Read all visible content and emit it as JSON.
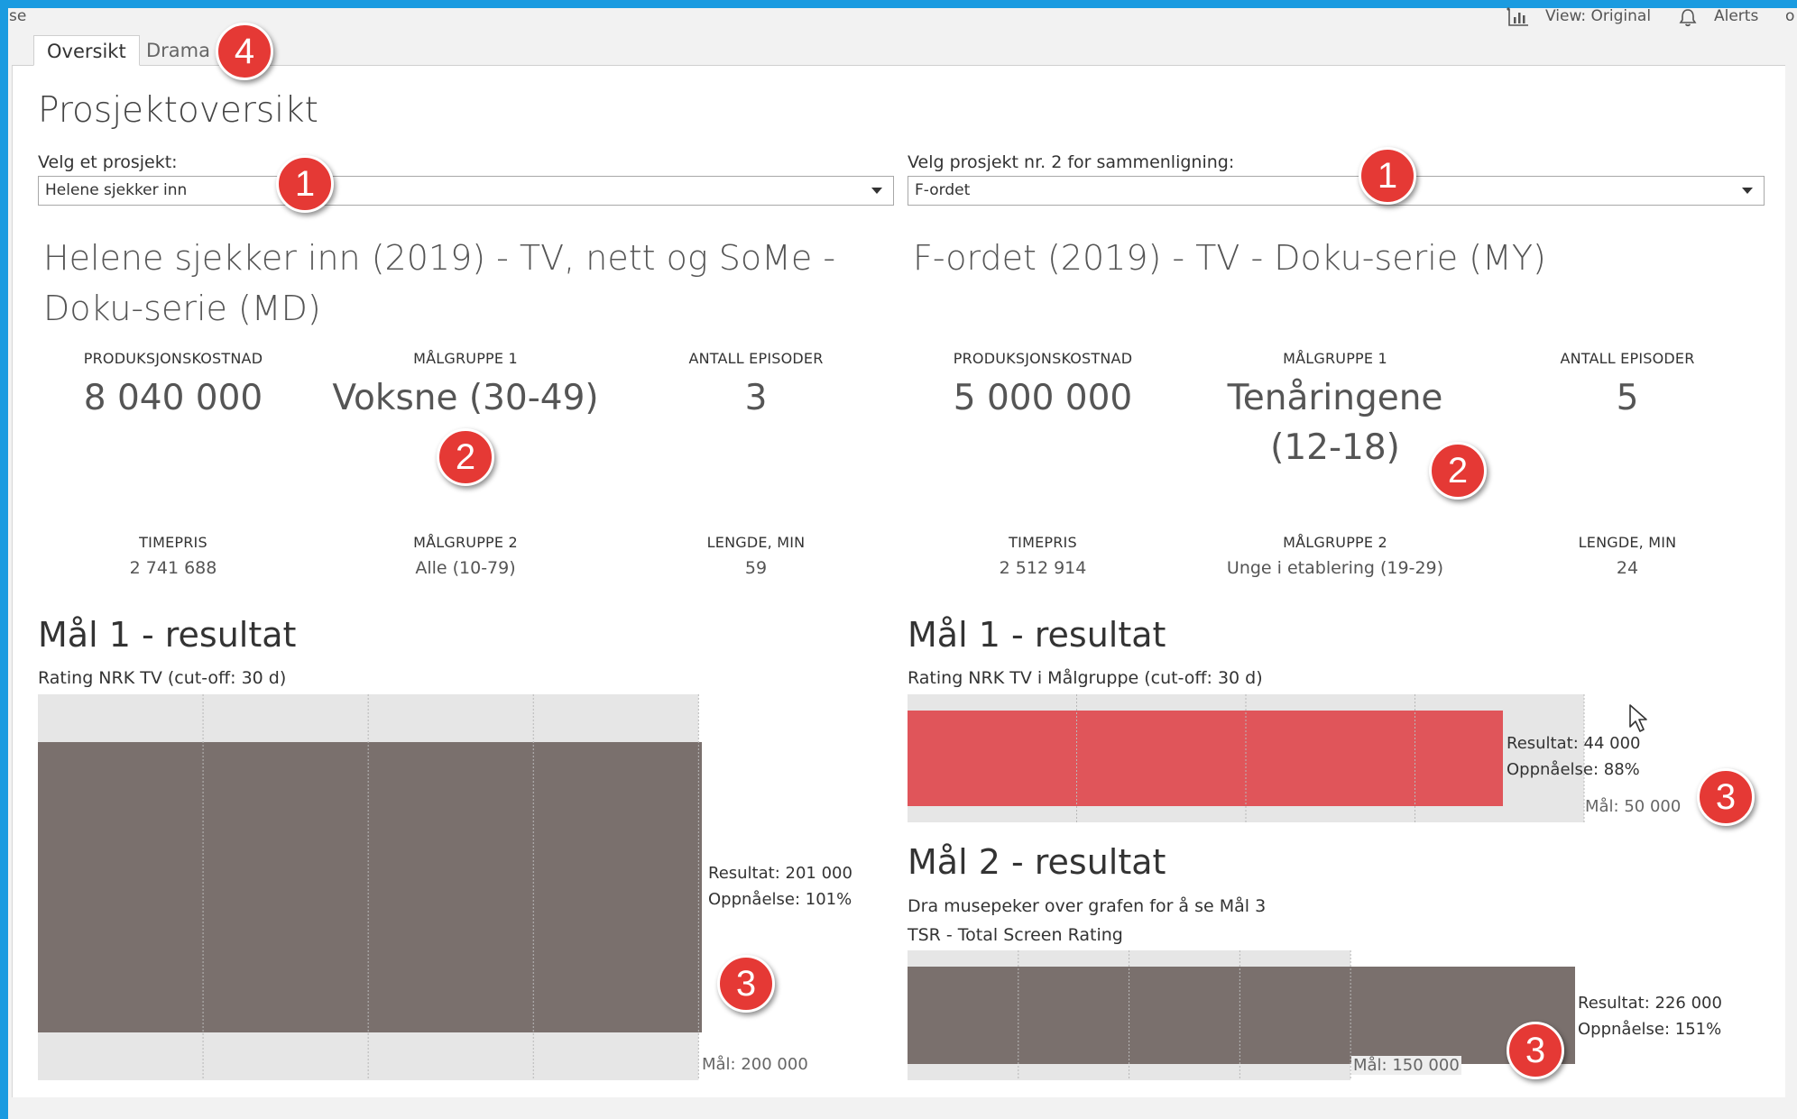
{
  "toolbar": {
    "left_fragment": "se",
    "view_label": "View: Original",
    "alerts_label": "Alerts",
    "right_fragment": "o"
  },
  "tabs": [
    {
      "label": "Oversikt",
      "active": true
    },
    {
      "label": "Drama",
      "active": false
    }
  ],
  "page_title": "Prosjektoversikt",
  "selectors": {
    "left": {
      "label": "Velg et prosjekt:",
      "value": "Helene sjekker inn"
    },
    "right": {
      "label": "Velg prosjekt nr. 2 for sammenligning:",
      "value": "F-ordet"
    }
  },
  "project_left": {
    "title_line1": "Helene sjekker inn (2019) - TV, nett og SoMe -",
    "title_line2": "Doku-serie (MD)",
    "kpis": {
      "prodcost_label": "PRODUKSJONSKOSTNAD",
      "prodcost_value": "8 040 000",
      "mg1_label": "MÅLGRUPPE 1",
      "mg1_value": "Voksne (30-49)",
      "episodes_label": "ANTALL EPISODER",
      "episodes_value": "3",
      "hourly_label": "TIMEPRIS",
      "hourly_value": "2 741 688",
      "mg2_label": "MÅLGRUPPE 2",
      "mg2_value": "Alle (10-79)",
      "length_label": "LENGDE, MIN",
      "length_value": "59"
    },
    "goal1": {
      "title": "Mål 1 - resultat",
      "subtitle": "Rating NRK TV (cut-off: 30 d)",
      "result_label": "Resultat: 201 000",
      "achievement_label": "Oppnåelse: 101%",
      "goal_label": "Mål: 200 000"
    }
  },
  "project_right": {
    "title_line1": "F-ordet (2019) - TV - Doku-serie (MY)",
    "kpis": {
      "prodcost_label": "PRODUKSJONSKOSTNAD",
      "prodcost_value": "5 000 000",
      "mg1_label": "MÅLGRUPPE 1",
      "mg1_value_line1": "Tenåringene",
      "mg1_value_line2": "(12-18)",
      "episodes_label": "ANTALL EPISODER",
      "episodes_value": "5",
      "hourly_label": "TIMEPRIS",
      "hourly_value": "2 512 914",
      "mg2_label": "MÅLGRUPPE 2",
      "mg2_value": "Unge i etablering (19-29)",
      "length_label": "LENGDE, MIN",
      "length_value": "24"
    },
    "goal1": {
      "title": "Mål 1 - resultat",
      "subtitle": "Rating NRK TV i Målgruppe (cut-off: 30 d)",
      "result_label": "Resultat: 44 000",
      "achievement_label": "Oppnåelse: 88%",
      "goal_label": "Mål: 50 000"
    },
    "goal2": {
      "title": "Mål 2 - resultat",
      "hint": "Dra musepeker over grafen for å se Mål 3",
      "subtitle": "TSR - Total Screen Rating",
      "result_label": "Resultat: 226 000",
      "achievement_label": "Oppnåelse: 151%",
      "goal_label": "Mål: 150 000"
    }
  },
  "badges": [
    "1",
    "1",
    "2",
    "2",
    "3",
    "3",
    "3",
    "4"
  ],
  "colors": {
    "accent_red": "#e53935",
    "bar_gray": "#7a706d",
    "bar_red": "#e0555a",
    "track_gray": "#e6e6e6",
    "frame_blue": "#1a9be0"
  },
  "chart_data": [
    {
      "type": "bar",
      "title": "Mål 1 - resultat",
      "categories": [
        "Resultat"
      ],
      "values": [
        201000
      ],
      "goal": 200000,
      "achievement_pct": 101,
      "orientation": "horizontal"
    },
    {
      "type": "bar",
      "title": "Mål 1 - resultat",
      "categories": [
        "Resultat"
      ],
      "values": [
        44000
      ],
      "goal": 50000,
      "achievement_pct": 88,
      "orientation": "horizontal"
    },
    {
      "type": "bar",
      "title": "Mål 2 - resultat",
      "categories": [
        "Resultat"
      ],
      "values": [
        226000
      ],
      "goal": 150000,
      "achievement_pct": 151,
      "orientation": "horizontal"
    }
  ]
}
